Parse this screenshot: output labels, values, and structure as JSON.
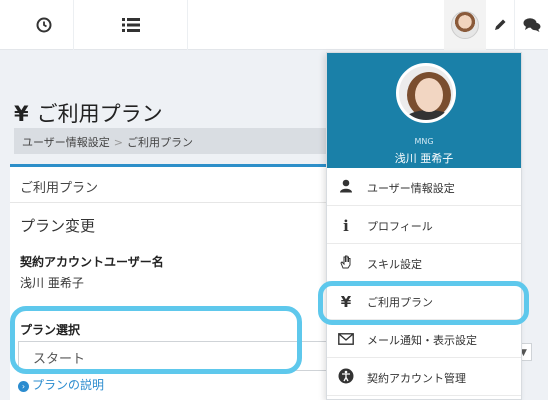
{
  "topbar": {
    "clock_icon": "clock-icon",
    "list_icon": "list-icon",
    "pencil_icon": "pencil-icon",
    "chat_icon": "chat-icon"
  },
  "page": {
    "title": "ご利用プラン",
    "yen": "¥",
    "breadcrumb": {
      "parent": "ユーザー情報設定",
      "separator": ">",
      "current": "ご利用プラン"
    }
  },
  "card": {
    "header": "ご利用プラン",
    "section_title": "プラン変更",
    "account_label": "契約アカウントユーザー名",
    "account_value": "浅川 亜希子",
    "plan_select_label": "プラン選択",
    "plan_select_value": "スタート",
    "plan_link": "プランの説明"
  },
  "dropdown": {
    "role": "MNG",
    "name": "浅川 亜希子",
    "items": [
      {
        "label": "ユーザー情報設定",
        "icon": "user-icon"
      },
      {
        "label": "プロフィール",
        "icon": "info-icon"
      },
      {
        "label": "スキル設定",
        "icon": "hand-icon"
      },
      {
        "label": "ご利用プラン",
        "icon": "yen-icon"
      },
      {
        "label": "メール通知・表示設定",
        "icon": "envelope-icon"
      },
      {
        "label": "契約アカウント管理",
        "icon": "accessibility-icon"
      }
    ]
  },
  "colors": {
    "accent": "#2d8fc9",
    "menu_header": "#1a80a8",
    "highlight": "#5ec8ec"
  }
}
